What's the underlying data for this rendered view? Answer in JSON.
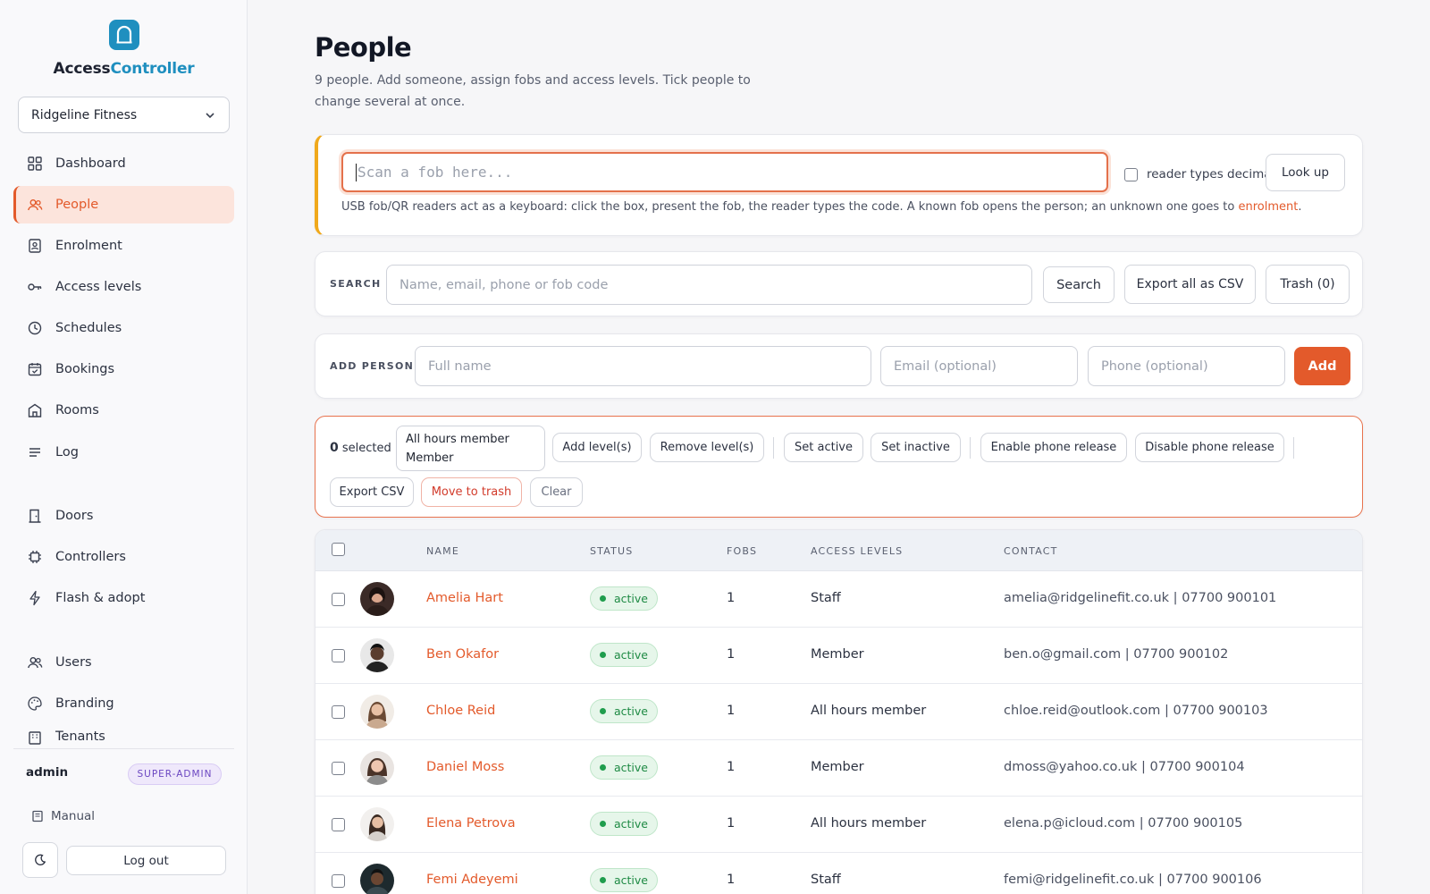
{
  "app": {
    "brand_part1": "Access",
    "brand_part2": "Controller",
    "accent_color": "#1f8fbf",
    "primary_color": "#e35a2b"
  },
  "sidebar": {
    "tenant": "Ridgeline Fitness",
    "items": [
      {
        "label": "Dashboard",
        "icon": "grid-icon",
        "active": false
      },
      {
        "label": "People",
        "icon": "users-icon",
        "active": true
      },
      {
        "label": "Enrolment",
        "icon": "id-badge-icon",
        "active": false
      },
      {
        "label": "Access levels",
        "icon": "key-icon",
        "active": false
      },
      {
        "label": "Schedules",
        "icon": "clock-icon",
        "active": false
      },
      {
        "label": "Bookings",
        "icon": "calendar-icon",
        "active": false
      },
      {
        "label": "Rooms",
        "icon": "room-icon",
        "active": false
      },
      {
        "label": "Log",
        "icon": "list-icon",
        "active": false
      },
      {
        "label": "Doors",
        "icon": "door-icon",
        "active": false
      },
      {
        "label": "Controllers",
        "icon": "chip-icon",
        "active": false
      },
      {
        "label": "Flash & adopt",
        "icon": "bolt-icon",
        "active": false
      },
      {
        "label": "Users",
        "icon": "users-icon",
        "active": false
      },
      {
        "label": "Branding",
        "icon": "palette-icon",
        "active": false
      },
      {
        "label": "Tenants",
        "icon": "building-icon",
        "active": false
      }
    ],
    "user": "admin",
    "role_badge": "SUPER-ADMIN",
    "manual": "Manual",
    "logout": "Log out"
  },
  "header": {
    "title": "People",
    "subtitle": "9 people. Add someone, assign fobs and access levels. Tick people to change several at once."
  },
  "scan": {
    "placeholder": "Scan a fob here...",
    "decimal_label": "reader types decimal",
    "lookup": "Look up",
    "help": "USB fob/QR readers act as a keyboard: click the box, present the fob, the reader types the code. A known fob opens the person; an unknown one goes to ",
    "help_link": "enrolment",
    "help_end": "."
  },
  "search": {
    "label": "SEARCH",
    "placeholder": "Name, email, phone or fob code",
    "search_btn": "Search",
    "export_btn": "Export all as CSV",
    "trash_btn": "Trash (0)"
  },
  "add_person": {
    "label": "ADD PERSON",
    "name_placeholder": "Full name",
    "email_placeholder": "Email (optional)",
    "phone_placeholder": "Phone (optional)",
    "add_btn": "Add"
  },
  "bulk": {
    "count": "0",
    "selected_label": "selected",
    "level_options": [
      "All hours member",
      "Member"
    ],
    "add_levels": "Add level(s)",
    "remove_levels": "Remove level(s)",
    "set_active": "Set active",
    "set_inactive": "Set inactive",
    "enable_phone": "Enable phone release",
    "disable_phone": "Disable phone release",
    "export_csv": "Export CSV",
    "move_trash": "Move to trash",
    "clear": "Clear"
  },
  "table": {
    "columns": [
      "NAME",
      "STATUS",
      "FOBS",
      "ACCESS LEVELS",
      "CONTACT"
    ],
    "rows": [
      {
        "name": "Amelia Hart",
        "status": "active",
        "fobs": "1",
        "level": "Staff",
        "email": "amelia@ridgelinefit.co.uk",
        "phone": "07700 900101"
      },
      {
        "name": "Ben Okafor",
        "status": "active",
        "fobs": "1",
        "level": "Member",
        "email": "ben.o@gmail.com",
        "phone": "07700 900102"
      },
      {
        "name": "Chloe Reid",
        "status": "active",
        "fobs": "1",
        "level": "All hours member",
        "email": "chloe.reid@outlook.com",
        "phone": "07700 900103"
      },
      {
        "name": "Daniel Moss",
        "status": "active",
        "fobs": "1",
        "level": "Member",
        "email": "dmoss@yahoo.co.uk",
        "phone": "07700 900104"
      },
      {
        "name": "Elena Petrova",
        "status": "active",
        "fobs": "1",
        "level": "All hours member",
        "email": "elena.p@icloud.com",
        "phone": "07700 900105"
      },
      {
        "name": "Femi Adeyemi",
        "status": "active",
        "fobs": "1",
        "level": "Staff",
        "email": "femi@ridgelinefit.co.uk",
        "phone": "07700 900106"
      }
    ]
  }
}
